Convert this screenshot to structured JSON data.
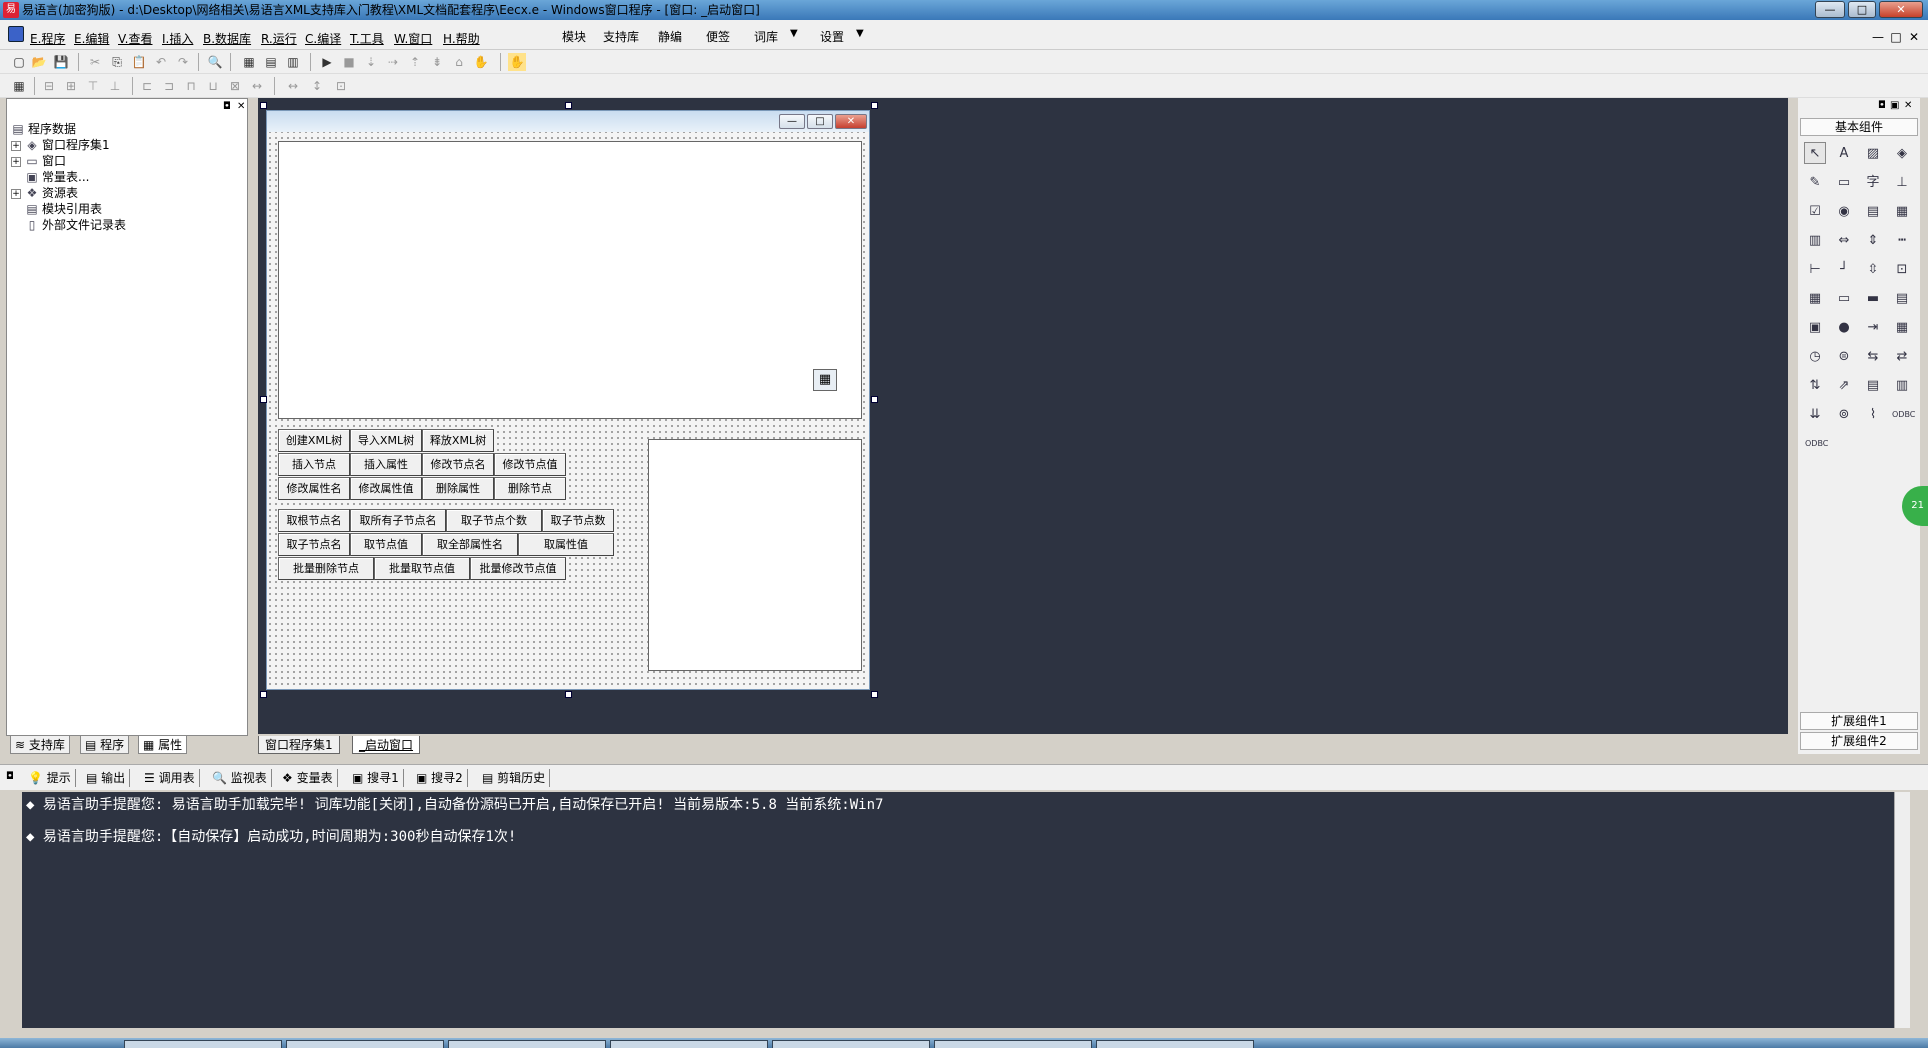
{
  "window": {
    "title": "易语言(加密狗版) - d:\\Desktop\\网络相关\\易语言XML支持库入门教程\\XML文档配套程序\\Eecx.e - Windows窗口程序 - [窗口: _启动窗口]",
    "min": "—",
    "max": "□",
    "close": "✕",
    "app_icon": "易"
  },
  "menu": {
    "items": [
      "E.程序",
      "E.编辑",
      "V.查看",
      "I.插入",
      "B.数据库",
      "R.运行",
      "C.编译",
      "T.工具",
      "W.窗口",
      "H.帮助"
    ],
    "extras": [
      "模块",
      "支持库",
      "静编",
      "便签",
      "词库",
      "设置"
    ],
    "dropdown": "▼"
  },
  "toolbar": {
    "row1": [
      "▢",
      "📂",
      "💾",
      "✂",
      "⎘",
      "📋",
      "↶",
      "↷",
      "🔍",
      "▦",
      "▤",
      "▥",
      "▶",
      "■",
      "⇣",
      "⇢",
      "⇡",
      "⇟",
      "⌂",
      "✋"
    ],
    "row2": [
      "▦",
      "⊟",
      "⊞",
      "⊤",
      "⊥",
      "⊏",
      "⊐",
      "⊓",
      "⊔",
      "⊠",
      "↔",
      "↕",
      "⊡"
    ]
  },
  "tree": {
    "items": [
      {
        "label": "程序数据",
        "icon": "▤"
      },
      {
        "label": "窗口程序集1",
        "icon": "◈",
        "toggle": "+"
      },
      {
        "label": "窗口",
        "icon": "▭",
        "toggle": "+"
      },
      {
        "label": "常量表...",
        "icon": "▣"
      },
      {
        "label": "资源表",
        "icon": "❖",
        "toggle": "+"
      },
      {
        "label": "模块引用表",
        "icon": "▤"
      },
      {
        "label": "外部文件记录表",
        "icon": "▯"
      }
    ]
  },
  "left_tabs": [
    "支持库",
    "程序",
    "属性"
  ],
  "form": {
    "buttons_row1": [
      "创建XML树",
      "导入XML树",
      "释放XML树"
    ],
    "buttons_row2": [
      "插入节点",
      "插入属性",
      "修改节点名",
      "修改节点值"
    ],
    "buttons_row3": [
      "修改属性名",
      "修改属性值",
      "删除属性",
      "删除节点"
    ],
    "buttons_row4": [
      "取根节点名",
      "取所有子节点名",
      "取子节点个数",
      "取子节点数"
    ],
    "buttons_row5": [
      "取子节点名",
      "取节点值",
      "取全部属性名",
      "取属性值"
    ],
    "buttons_row6": [
      "批量删除节点",
      "批量取节点值",
      "批量修改节点值"
    ],
    "calendar_icon": "▦"
  },
  "designer_tabs": [
    "窗口程序集1",
    "_启动窗口"
  ],
  "toolbox": {
    "header": "基本组件",
    "ext1": "扩展组件1",
    "ext2": "扩展组件2",
    "icons": [
      "↖",
      "A",
      "▨",
      "◈",
      "✎",
      "▭",
      "字",
      "⊥",
      "☑",
      "◉",
      "▤",
      "▦",
      "▥",
      "⇔",
      "⇕",
      "┅",
      "⊢",
      "┘",
      "⇳",
      "⊡",
      "▦",
      "▭",
      "▬",
      "▤",
      "▣",
      "●",
      "⇥",
      "▦",
      "◷",
      "⊜",
      "⇆",
      "⇄",
      "⇅",
      "⇗",
      "▤",
      "▥",
      "⇊",
      "⊚",
      "⌇",
      "ODBC",
      "ODBC"
    ]
  },
  "output_tabs": [
    "提示",
    "输出",
    "调用表",
    "监视表",
    "变量表",
    "搜寻1",
    "搜寻2",
    "剪辑历史"
  ],
  "output": {
    "messages": [
      "易语言助手提醒您:  易语言助手加载完毕! 词库功能[关闭],自动备份源码已开启,自动保存已开启! 当前易版本:5.8  当前系统:Win7",
      "易语言助手提醒您:【自动保存】启动成功,时间周期为:300秒自动保存1次!"
    ],
    "bullet": "◆"
  },
  "badge": "21"
}
